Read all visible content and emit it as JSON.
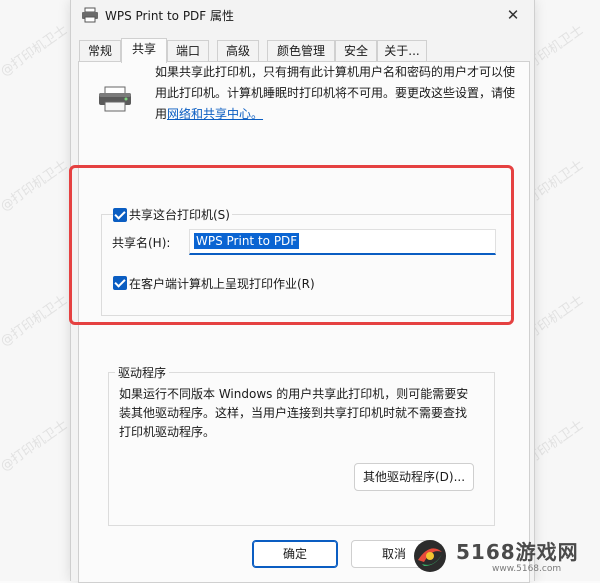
{
  "window": {
    "title": "WPS Print to PDF 属性",
    "close_glyph": "✕"
  },
  "tabs": [
    {
      "label": "常规"
    },
    {
      "label": "共享"
    },
    {
      "label": "端口"
    },
    {
      "label": "高级"
    },
    {
      "label": "颜色管理"
    },
    {
      "label": "安全"
    },
    {
      "label": "关于..."
    }
  ],
  "sharing": {
    "description_line1": "如果共享此打印机，只有拥有此计算机用户名和密码的用户才可以使",
    "description_line2": "用此打印机。计算机睡眠时打印机将不可用。要更改这些设置，请使",
    "description_line3_prefix": "用",
    "network_link": "网络和共享中心。",
    "share_checkbox_label": "共享这台打印机(S)",
    "share_name_label": "共享名(H):",
    "share_name_value": "WPS Print to PDF",
    "render_checkbox_label": "在客户端计算机上呈现打印作业(R)"
  },
  "drivers": {
    "title": "驱动程序",
    "text_line1": "如果运行不同版本 Windows 的用户共享此打印机，则可能需要安",
    "text_line2": "装其他驱动程序。这样，当用户连接到共享打印机时就不需要查找",
    "text_line3": "打印机驱动程序。",
    "button_label": "其他驱动程序(D)..."
  },
  "footer": {
    "ok_label": "确定",
    "cancel_label": "取消"
  },
  "watermark": {
    "text": "@打印机卫士"
  },
  "logo": {
    "text": "5168游戏网",
    "url": "www.5168.com"
  },
  "colors": {
    "accent": "#0a5dc2",
    "highlight_border": "#e54141"
  },
  "icons": {
    "title": "printer-icon",
    "close": "close-icon",
    "printer": "printer-icon",
    "checkbox": "checkbox-checked-icon"
  }
}
